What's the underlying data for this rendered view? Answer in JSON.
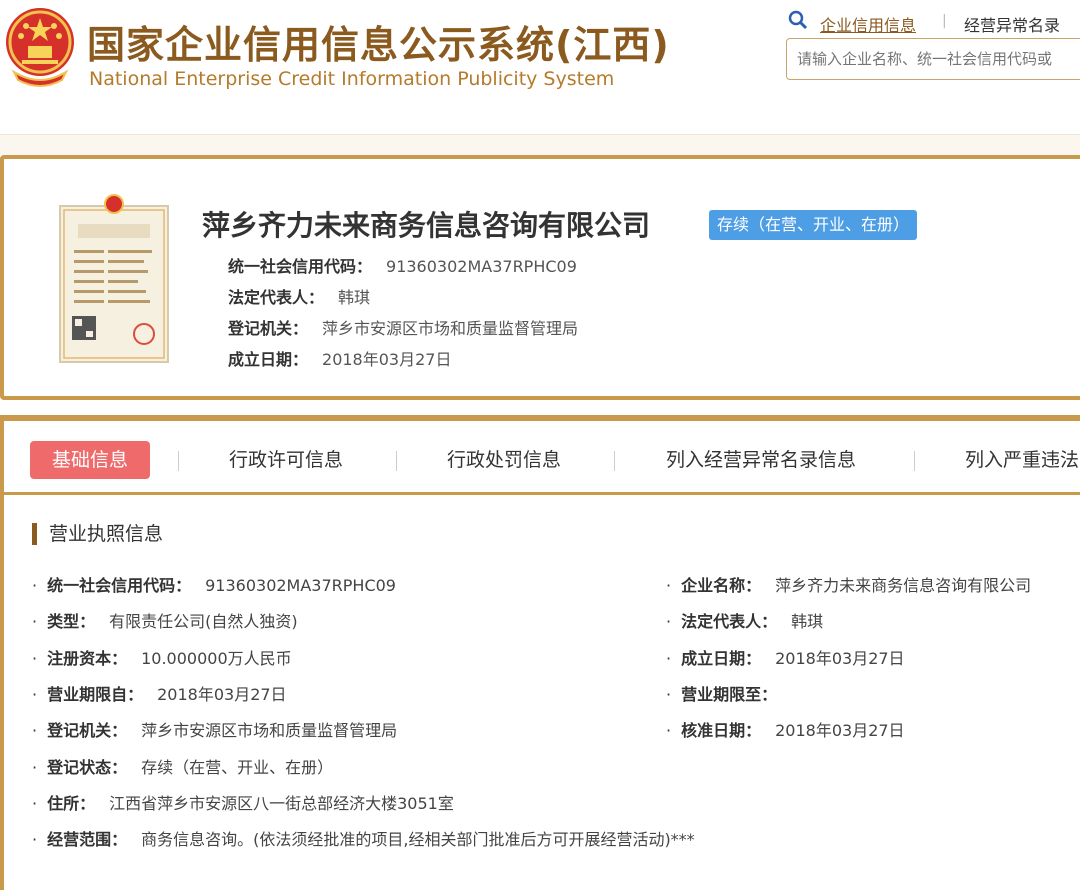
{
  "header": {
    "site_title": "国家企业信用信息公示系统(江西)",
    "site_subtitle": "National Enterprise Credit Information Publicity System",
    "nav_credit": "企业信用信息",
    "nav_sep": "|",
    "nav_abnormal": "经营异常名录",
    "search_placeholder": "请输入企业名称、统一社会信用代码或"
  },
  "company": {
    "name": "萍乡齐力未来商务信息咨询有限公司",
    "status": "存续（在营、开业、在册）",
    "rows": [
      {
        "label": "统一社会信用代码：",
        "value": "91360302MA37RPHC09"
      },
      {
        "label": "法定代表人：",
        "value": "韩琪"
      },
      {
        "label": "登记机关：",
        "value": "萍乡市安源区市场和质量监督管理局"
      },
      {
        "label": "成立日期：",
        "value": "2018年03月27日"
      }
    ],
    "license_text": "营业执照"
  },
  "tabs": [
    {
      "label": "基础信息",
      "active": true
    },
    {
      "label": "行政许可信息",
      "active": false
    },
    {
      "label": "行政处罚信息",
      "active": false
    },
    {
      "label": "列入经营异常名录信息",
      "active": false
    },
    {
      "label": "列入严重违法",
      "active": false
    }
  ],
  "details": {
    "section_title": "营业执照信息",
    "left": [
      {
        "label": "统一社会信用代码：",
        "value": "91360302MA37RPHC09"
      },
      {
        "label": "类型：",
        "value": "有限责任公司(自然人独资)"
      },
      {
        "label": "注册资本：",
        "value": "10.000000万人民币"
      },
      {
        "label": "营业期限自：",
        "value": "2018年03月27日"
      },
      {
        "label": "登记机关：",
        "value": "萍乡市安源区市场和质量监督管理局"
      },
      {
        "label": "登记状态：",
        "value": "存续（在营、开业、在册）"
      },
      {
        "label": "住所：",
        "value": "江西省萍乡市安源区八一街总部经济大楼3051室"
      },
      {
        "label": "经营范围：",
        "value": "商务信息咨询。(依法须经批准的项目,经相关部门批准后方可开展经营活动)***"
      }
    ],
    "right": [
      {
        "label": "企业名称：",
        "value": "萍乡齐力未来商务信息咨询有限公司"
      },
      {
        "label": "法定代表人：",
        "value": "韩琪"
      },
      {
        "label": "成立日期：",
        "value": "2018年03月27日"
      },
      {
        "label": "营业期限至：",
        "value": ""
      },
      {
        "label": "核准日期：",
        "value": "2018年03月27日"
      }
    ]
  },
  "colors": {
    "brand_brown": "#8a5a1e",
    "border_gold": "#c99a4b",
    "badge_blue": "#4e9ee6",
    "active_tab_red": "#ef6b6b"
  }
}
